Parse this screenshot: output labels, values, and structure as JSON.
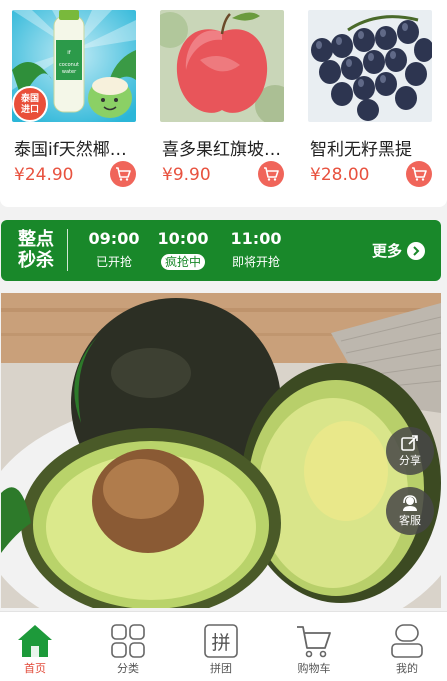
{
  "products": [
    {
      "name": "泰国if天然椰子水",
      "price": "¥24.90",
      "badge": "泰国\n进口",
      "brand_text": "if coconut water"
    },
    {
      "name": "喜多果红旗坡苹果",
      "price": "¥9.90"
    },
    {
      "name": "智利无籽黑提",
      "price": "¥28.00"
    }
  ],
  "flash_sale": {
    "title_line1": "整点",
    "title_line2": "秒杀",
    "slots": [
      {
        "time": "09:00",
        "status": "已开抢"
      },
      {
        "time": "10:00",
        "status": "疯抢中"
      },
      {
        "time": "11:00",
        "status": "即将开抢"
      }
    ],
    "more_label": "更多"
  },
  "floating": {
    "share_label": "分享",
    "service_label": "客服"
  },
  "tabbar": {
    "items": [
      {
        "label": "首页",
        "icon": "home-icon"
      },
      {
        "label": "分类",
        "icon": "category-icon"
      },
      {
        "label": "拼团",
        "icon": "group-buy-icon"
      },
      {
        "label": "购物车",
        "icon": "cart-icon"
      },
      {
        "label": "我的",
        "icon": "profile-icon"
      }
    ],
    "active_index": 0
  },
  "colors": {
    "accent_green": "#19882a",
    "price_red": "#e8523f",
    "cart_btn": "#f0655a",
    "active_tab": "#e24b3a"
  }
}
